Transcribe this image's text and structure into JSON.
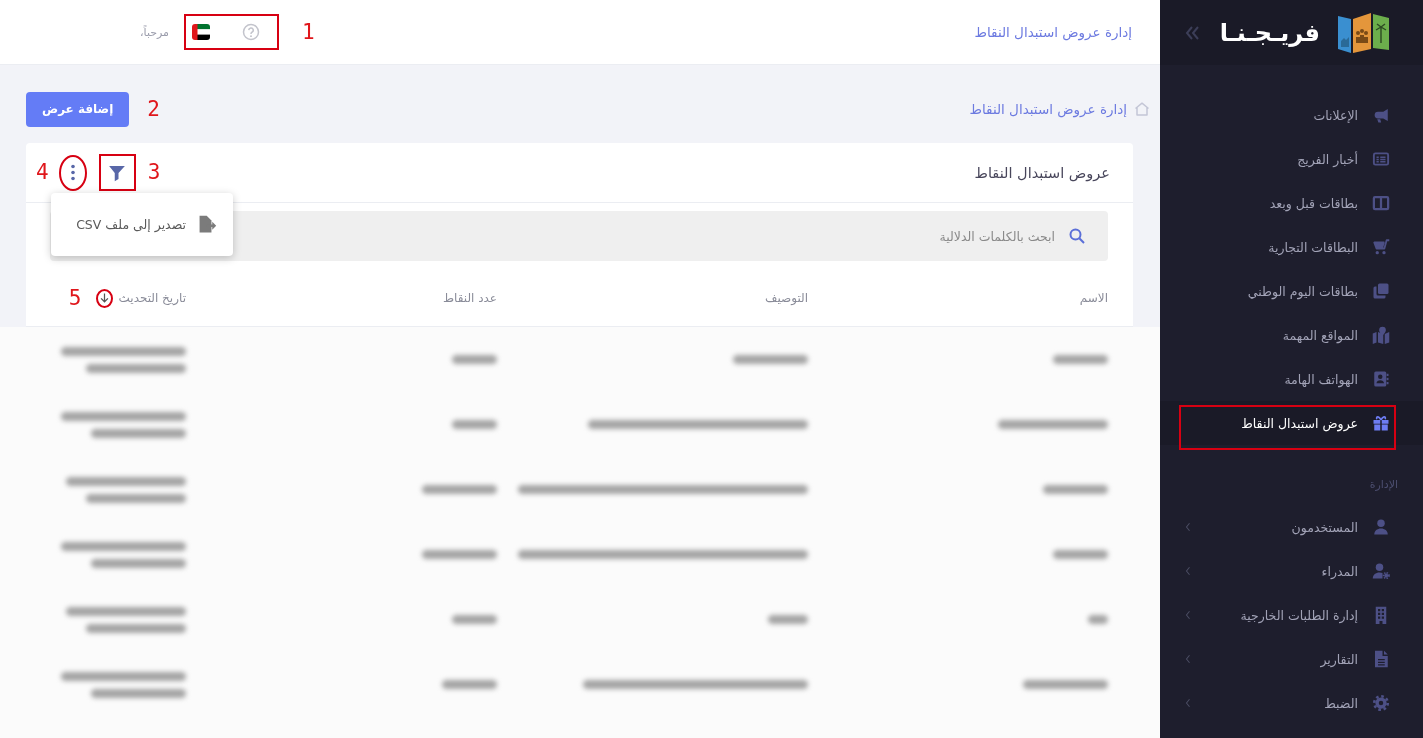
{
  "sidebar": {
    "logo": {
      "text": "فريـجـنـا"
    },
    "sections": [
      {
        "items": [
          {
            "label": "الإعلانات",
            "kind": "link",
            "selected": false,
            "annotated": false
          },
          {
            "label": "أخبار الفريج",
            "kind": "link",
            "selected": false,
            "annotated": false
          },
          {
            "label": "بطاقات قبل وبعد",
            "kind": "link",
            "selected": false,
            "annotated": false
          },
          {
            "label": "البطاقات التجارية",
            "kind": "link",
            "selected": false,
            "annotated": false
          },
          {
            "label": "بطاقات اليوم الوطني",
            "kind": "link",
            "selected": false,
            "annotated": false
          },
          {
            "label": "المواقع المهمة",
            "kind": "link",
            "selected": false,
            "annotated": false
          },
          {
            "label": "الهواتف الهامة",
            "kind": "link",
            "selected": false,
            "annotated": false
          },
          {
            "label": "عروض استبدال النقاط",
            "kind": "link",
            "selected": true,
            "annotated": true
          }
        ]
      },
      {
        "title": "الإدارة",
        "items": [
          {
            "label": "المستخدمون",
            "kind": "menu",
            "selected": false,
            "annotated": false
          },
          {
            "label": "المدراء",
            "kind": "menu",
            "selected": false,
            "annotated": false
          },
          {
            "label": "إدارة الطلبات الخارجية",
            "kind": "menu",
            "selected": false,
            "annotated": false
          },
          {
            "label": "التقارير",
            "kind": "menu",
            "selected": false,
            "annotated": false
          },
          {
            "label": "الضبط",
            "kind": "menu",
            "selected": false,
            "annotated": false
          }
        ]
      }
    ]
  },
  "header": {
    "title": "إدارة عروض استبدال النقاط",
    "greeting": "مرحباً،",
    "annotation": {
      "label": "1",
      "kind": "box"
    }
  },
  "subheader": {
    "breadcrumb": "إدارة عروض استبدال النقاط",
    "add_button": {
      "label": "إضافة عرض",
      "annotation": {
        "label": "2"
      }
    }
  },
  "card": {
    "title": "عروض استبدال النقاط",
    "filter_button": {
      "annotation": {
        "label": "3",
        "kind": "box"
      }
    },
    "more_button": {
      "expanded": true,
      "annotation": {
        "label": "4",
        "kind": "oval"
      }
    },
    "menu": [
      {
        "label": "تصدير إلى ملف CSV"
      }
    ],
    "search": {
      "placeholder": "ابحث بالكلمات الدلالية"
    },
    "columns": [
      {
        "label": "الاسم"
      },
      {
        "label": "التوصيف"
      },
      {
        "label": "عدد النقاط"
      },
      {
        "label": "تاريخ التحديث",
        "sorted": true,
        "descending": true,
        "annotation": {
          "label": "5",
          "kind": "oval"
        }
      }
    ]
  }
}
